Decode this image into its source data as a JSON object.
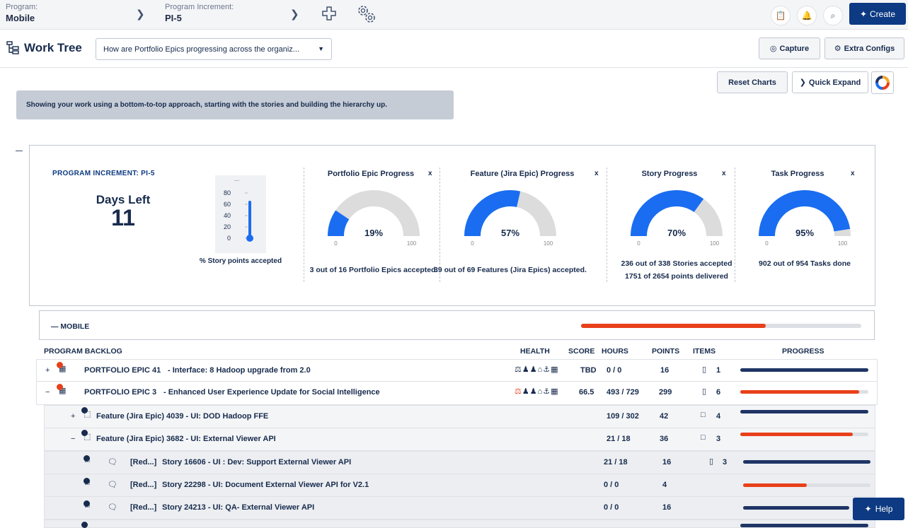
{
  "topbar": {
    "program_label": "Program:",
    "program_value": "Mobile",
    "pi_label": "Program Increment:",
    "pi_value": "PI-5",
    "create_label": "Create"
  },
  "toolbar": {
    "title": "Work Tree",
    "query_value": "How are Portfolio Epics progressing across the organiz...",
    "capture_label": "Capture",
    "extra_configs_label": "Extra Configs"
  },
  "actions": {
    "reset_charts_label": "Reset Charts",
    "quick_expand_label": "Quick Expand"
  },
  "banner": "Showing your work using a bottom-to-top approach, starting with the stories and building the hierarchy up.",
  "summary": {
    "pi_label": "PROGRAM INCREMENT: PI-5",
    "days_left_label": "Days Left",
    "days_left_value": "11",
    "thermometer": {
      "ticks": [
        "80",
        "60",
        "40",
        "20",
        "0"
      ],
      "value_percent": 0,
      "caption": "% Story points accepted"
    },
    "gauges": [
      {
        "title": "Portfolio Epic Progress",
        "percent": 19,
        "percent_label": "19%",
        "min": "0",
        "max": "100",
        "close": "x",
        "caption1": "3 out of 16 Portfolio Epics accepted.",
        "caption2": ""
      },
      {
        "title": "Feature (Jira Epic) Progress",
        "percent": 57,
        "percent_label": "57%",
        "min": "0",
        "max": "100",
        "close": "x",
        "caption1": "39 out of 69 Features (Jira Epics) accepted.",
        "caption2": ""
      },
      {
        "title": "Story Progress",
        "percent": 70,
        "percent_label": "70%",
        "min": "0",
        "max": "100",
        "close": "x",
        "caption1": "236 out of 338 Stories accepted",
        "caption2": "1751 of 2654 points delivered"
      },
      {
        "title": "Task Progress",
        "percent": 95,
        "percent_label": "95%",
        "min": "0",
        "max": "100",
        "close": "x",
        "caption1": "902 out of 954 Tasks done",
        "caption2": ""
      }
    ]
  },
  "mobile": {
    "label": "MOBILE",
    "progress": 0.66
  },
  "table": {
    "headers": {
      "backlog": "PROGRAM BACKLOG",
      "health": "HEALTH",
      "score": "SCORE",
      "hours": "HOURS",
      "points": "POINTS",
      "items": "ITEMS",
      "progress": "PROGRESS"
    },
    "rows": [
      {
        "toggle": "+",
        "title": "PORTFOLIO EPIC 41",
        "desc": "- Interface: 8 Hadoop upgrade from 2.0",
        "score": "TBD",
        "hours": "0 / 0",
        "points": "16",
        "items": "1",
        "progress": 1.0,
        "color": "#1f3566"
      },
      {
        "toggle": "−",
        "title": "PORTFOLIO EPIC 3",
        "desc": "- Enhanced User Experience Update for Social Intelligence",
        "score": "66.5",
        "hours": "493 / 729",
        "points": "299",
        "items": "6",
        "progress": 0.93,
        "color": "#e8401a"
      },
      {
        "toggle": "+",
        "title": "Feature (Jira Epic) 4039 - UI: DOD Hadoop FFE",
        "hours": "109 / 302",
        "points": "42",
        "items": "4",
        "progress": 1.0,
        "color": "#1f3566"
      },
      {
        "toggle": "−",
        "title": "Feature (Jira Epic) 3682 - UI: External Viewer API",
        "hours": "21 / 18",
        "points": "36",
        "items": "3",
        "progress": 0.88,
        "color": "#e8401a"
      },
      {
        "prefix": "[Red...]",
        "title": "Story 16606 - UI : Dev: Support External Viewer API",
        "hours": "21 / 18",
        "points": "16",
        "items": "3",
        "progress": 1.0,
        "color": "#1f3566"
      },
      {
        "prefix": "[Red...]",
        "title": "Story 22298 - UI: Document External Viewer API for V2.1",
        "hours": "0 / 0",
        "points": "4",
        "items": "",
        "progress": 0.5,
        "color": "#e8401a"
      },
      {
        "prefix": "[Red...]",
        "title": "Story 24213 - UI: QA- External Viewer API",
        "hours": "0 / 0",
        "points": "16",
        "items": "",
        "progress": 1.0,
        "color": "#1f3566"
      }
    ]
  },
  "help_label": "Help",
  "colors": {
    "accent": "#0d3a82",
    "gauge_fill": "#1a6df0",
    "gauge_track": "#dcdcdc",
    "warn": "#e8401a",
    "navy": "#1f3566"
  }
}
